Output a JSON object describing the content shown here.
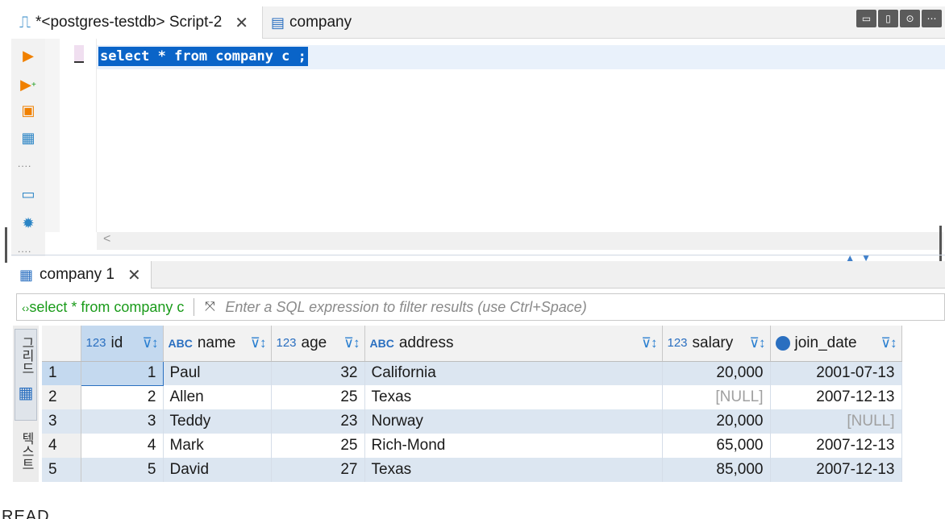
{
  "editor_tabs": [
    {
      "label": "*<postgres-testdb> Script-2",
      "active": true
    },
    {
      "label": "company",
      "active": false
    }
  ],
  "window_buttons": [
    "comment-icon",
    "panel-icon",
    "download-icon",
    "more-icon"
  ],
  "editor": {
    "sql": "select * from company c ;"
  },
  "results": {
    "tab_label": "company 1",
    "filter_query": "select * from company c",
    "filter_placeholder": "Enter a SQL expression to filter results (use Ctrl+Space)",
    "side_tabs": [
      "그리드",
      "텍스트"
    ],
    "columns": [
      {
        "name": "id",
        "type": "123"
      },
      {
        "name": "name",
        "type": "ABC"
      },
      {
        "name": "age",
        "type": "123"
      },
      {
        "name": "address",
        "type": "ABC"
      },
      {
        "name": "salary",
        "type": "123"
      },
      {
        "name": "join_date",
        "type": "date"
      }
    ],
    "rows": [
      {
        "n": "1",
        "id": "1",
        "name": "Paul",
        "age": "32",
        "address": "California",
        "salary": "20,000",
        "join_date": "2001-07-13"
      },
      {
        "n": "2",
        "id": "2",
        "name": "Allen",
        "age": "25",
        "address": "Texas",
        "salary": "[NULL]",
        "join_date": "2007-12-13"
      },
      {
        "n": "3",
        "id": "3",
        "name": "Teddy",
        "age": "23",
        "address": "Norway",
        "salary": "20,000",
        "join_date": "[NULL]"
      },
      {
        "n": "4",
        "id": "4",
        "name": "Mark",
        "age": "25",
        "address": "Rich-Mond",
        "salary": "65,000",
        "join_date": "2007-12-13"
      },
      {
        "n": "5",
        "id": "5",
        "name": "David",
        "age": "27",
        "address": "Texas",
        "salary": "85,000",
        "join_date": "2007-12-13"
      }
    ]
  },
  "footer_text": "READ"
}
